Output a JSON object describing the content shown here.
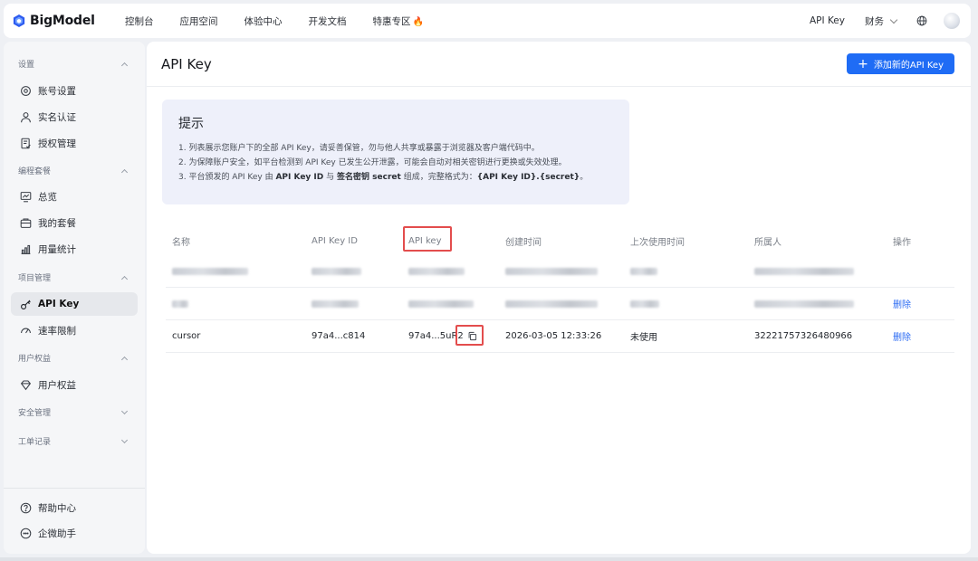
{
  "brand": {
    "name": "BigModel"
  },
  "nav": [
    "控制台",
    "应用空间",
    "体验中心",
    "开发文档",
    "特惠专区"
  ],
  "top_right": {
    "api_key": "API Key",
    "finance": "财务"
  },
  "icons": {
    "fire": "fire-icon",
    "globe": "globe-icon",
    "avatar": "avatar"
  },
  "sidebar": {
    "groups": {
      "settings": "设置",
      "coding_plan": "编程套餐",
      "project": "项目管理",
      "user_rights": "用户权益",
      "security": "安全管理",
      "tickets": "工单记录"
    },
    "items": {
      "account": "账号设置",
      "realname": "实名认证",
      "auth": "授权管理",
      "overview": "总览",
      "my_plan": "我的套餐",
      "usage": "用量统计",
      "api_key": "API Key",
      "rate_limit": "速率限制",
      "user_rights": "用户权益",
      "help": "帮助中心",
      "assistant": "企微助手"
    }
  },
  "main": {
    "title": "API Key",
    "add_button": "添加新的API Key",
    "tip": {
      "title": "提示",
      "line1": "1. 列表展示您账户下的全部 API Key，请妥善保管，勿与他人共享或暴露于浏览器及客户端代码中。",
      "line2": "2. 为保障账户安全，如平台检测到 API Key 已发生公开泄露，可能会自动对相关密钥进行更换或失效处理。",
      "line3_a": "3. 平台颁发的 API Key 由",
      "line3_b": "API Key ID",
      "line3_c": "与",
      "line3_d": "签名密钥 secret",
      "line3_e": "组成，完整格式为：",
      "line3_f": "{API Key ID}.{secret}",
      "line3_g": "。"
    },
    "table": {
      "headers": [
        "名称",
        "API Key ID",
        "API key",
        "创建时间",
        "上次使用时间",
        "所属人",
        "操作"
      ],
      "rows": [
        {
          "name": "",
          "key_id": "",
          "api_key": "",
          "created": "",
          "last_used": "",
          "owner": "",
          "action": ""
        },
        {
          "name": "",
          "key_id": "",
          "api_key": "",
          "created": "",
          "last_used": "",
          "owner": "",
          "action": "删除"
        },
        {
          "name": "cursor",
          "key_id": "97a4...c814",
          "api_key": "97a4...5uR2",
          "created": "2026-03-05 12:33:26",
          "last_used": "未使用",
          "owner": "32221757326480966",
          "action": "删除"
        }
      ]
    }
  },
  "colors": {
    "primary": "#1f6cf5",
    "highlight": "#e34d4d",
    "link": "#2b6bf3"
  }
}
